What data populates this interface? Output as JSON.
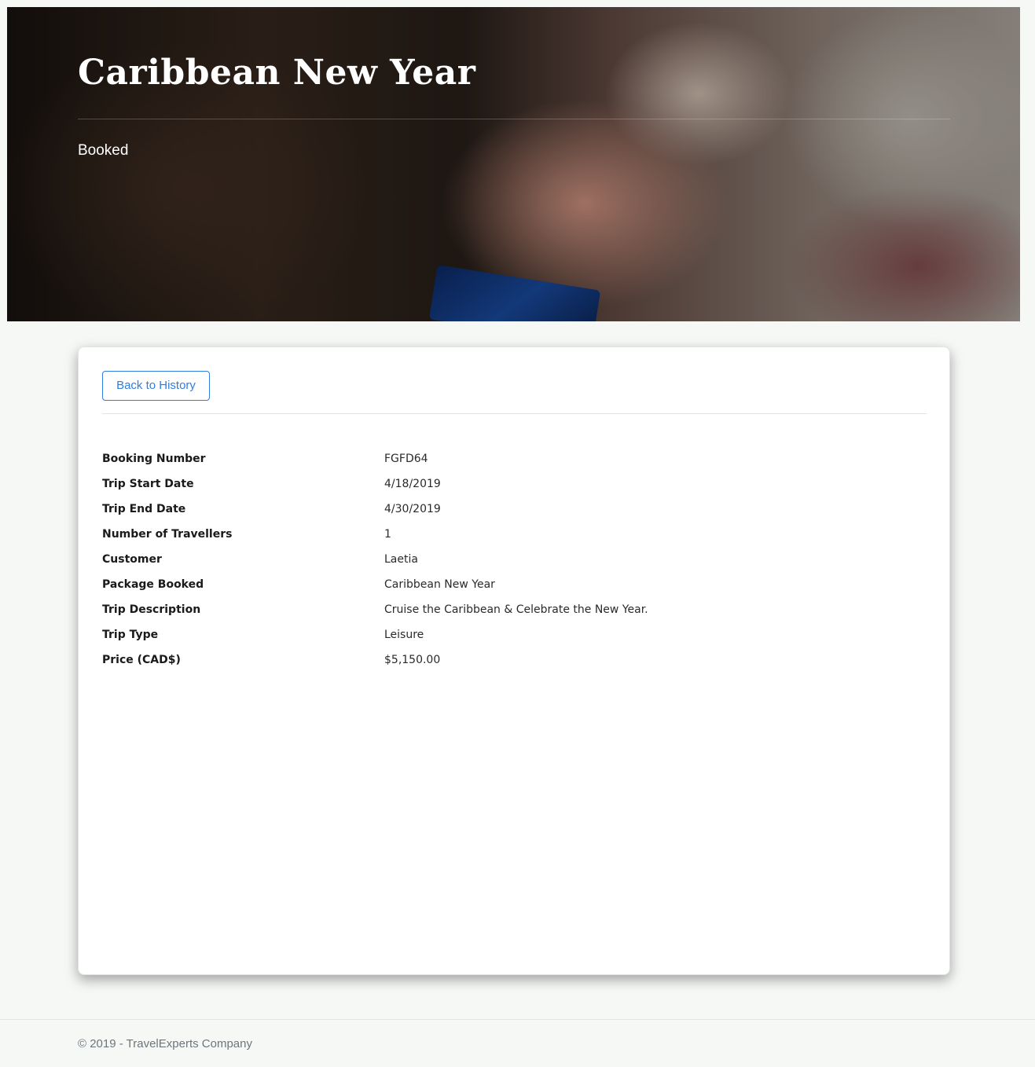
{
  "hero": {
    "title": "Caribbean New Year",
    "status": "Booked"
  },
  "card": {
    "back_button_label": "Back to History",
    "details": [
      {
        "label": "Booking Number",
        "value": "FGFD64"
      },
      {
        "label": "Trip Start Date",
        "value": "4/18/2019"
      },
      {
        "label": "Trip End Date",
        "value": "4/30/2019"
      },
      {
        "label": "Number of Travellers",
        "value": "1"
      },
      {
        "label": "Customer",
        "value": "Laetia"
      },
      {
        "label": "Package Booked",
        "value": "Caribbean New Year"
      },
      {
        "label": "Trip Description",
        "value": "Cruise the Caribbean & Celebrate the New Year."
      },
      {
        "label": "Trip Type",
        "value": "Leisure"
      },
      {
        "label": "Price (CAD$)",
        "value": "$5,150.00"
      }
    ]
  },
  "footer": {
    "text": "© 2019 - TravelExperts Company"
  },
  "colors": {
    "accent": "#2f7de1",
    "page_background": "#f6f8f6"
  }
}
